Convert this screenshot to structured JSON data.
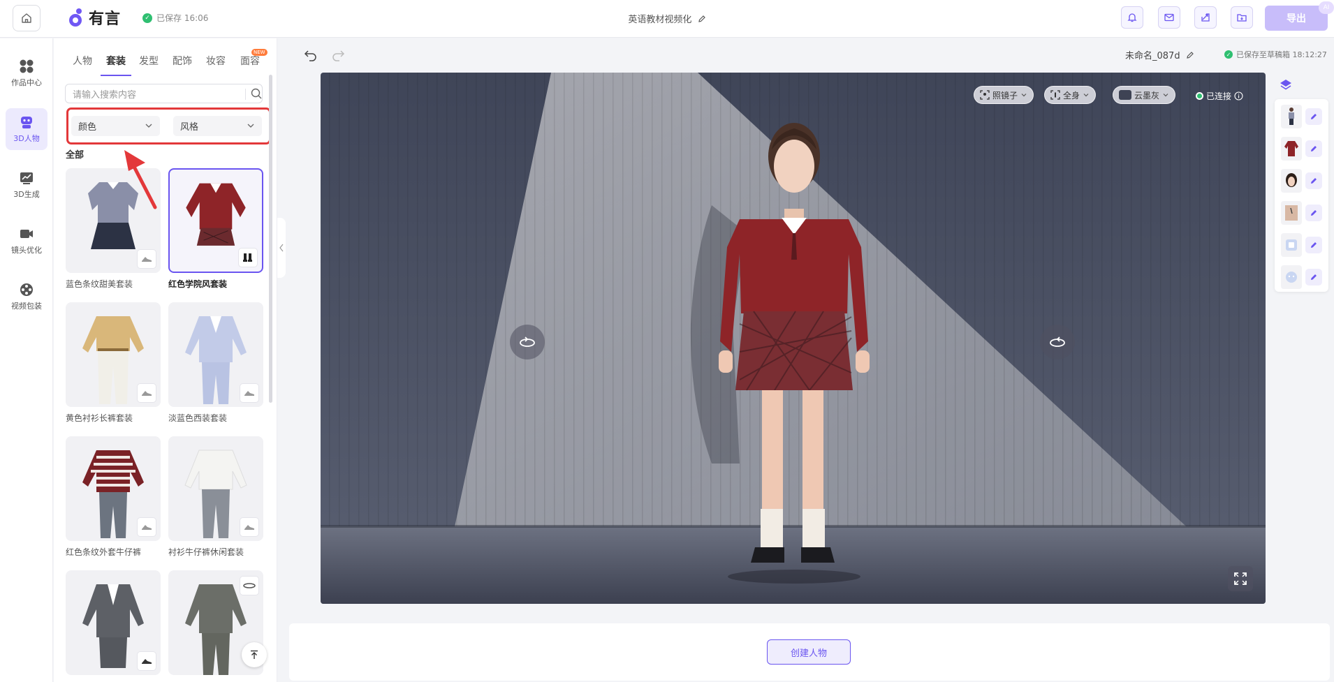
{
  "header": {
    "logo_text": "有言",
    "saved_status": "已保存 16:06",
    "document_title": "英语教材视频化",
    "export_label": "导出",
    "ai_badge": "AI"
  },
  "rail": {
    "items": [
      {
        "label": "作品中心",
        "icon": "grid-icon"
      },
      {
        "label": "3D人物",
        "icon": "robot-icon"
      },
      {
        "label": "3D生成",
        "icon": "chart-icon"
      },
      {
        "label": "镜头优化",
        "icon": "camera-icon"
      },
      {
        "label": "视频包装",
        "icon": "film-reel-icon"
      }
    ],
    "active_index": 1
  },
  "panel": {
    "tabs": [
      "人物",
      "套装",
      "发型",
      "配饰",
      "妆容",
      "面容"
    ],
    "active_tab": "套装",
    "new_badge": "NEW",
    "search_placeholder": "请输入搜索内容",
    "filters": {
      "color": "颜色",
      "style": "风格"
    },
    "section_title": "全部",
    "outfits": [
      {
        "name": "蓝色条纹甜美套装",
        "selected": false
      },
      {
        "name": "红色学院风套装",
        "selected": true
      },
      {
        "name": "黄色衬衫长裤套装",
        "selected": false
      },
      {
        "name": "淡蓝色西装套装",
        "selected": false
      },
      {
        "name": "红色条纹外套牛仔裤",
        "selected": false
      },
      {
        "name": "衬衫牛仔裤休闲套装",
        "selected": false
      },
      {
        "name": "",
        "selected": false
      },
      {
        "name": "",
        "selected": false
      }
    ]
  },
  "workspace": {
    "project_name": "未命名_087d",
    "draft_status": "已保存至草稿箱 18:12:27",
    "stage_controls": {
      "camera": "照镜子",
      "framing": "全身",
      "background": "云墨灰",
      "connection": "已连接"
    },
    "create_button": "创建人物"
  },
  "colors": {
    "accent": "#6a55f0",
    "annotation": "#e3383a",
    "success": "#2fbf71",
    "stage_wall": "#4a5164",
    "cardigan": "#8e2428"
  }
}
